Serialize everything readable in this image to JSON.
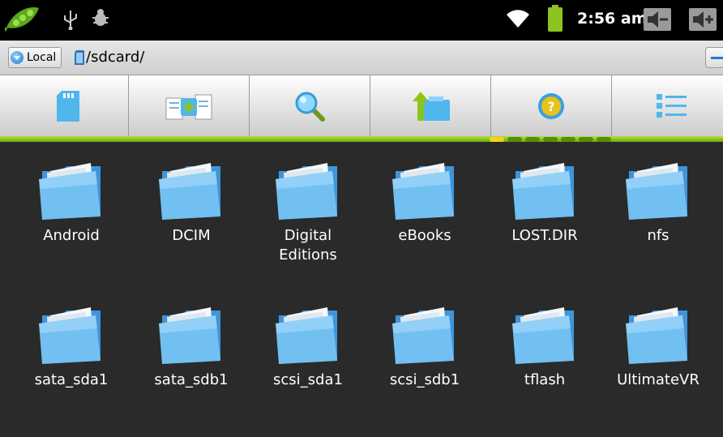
{
  "status_bar": {
    "time": "2:56 am",
    "left_icons": [
      "pea-pod-icon",
      "usb-icon",
      "debug-icon"
    ],
    "right_icons": [
      "wifi-icon",
      "battery-icon",
      "volume-down-icon",
      "volume-up-icon"
    ]
  },
  "path_bar": {
    "location_label": "Local",
    "path": "/sdcard/"
  },
  "toolbar": {
    "buttons": [
      {
        "icon": "sdcard-icon"
      },
      {
        "icon": "multi-select-icon"
      },
      {
        "icon": "search-icon"
      },
      {
        "icon": "up-folder-icon"
      },
      {
        "icon": "help-icon"
      },
      {
        "icon": "list-view-icon"
      }
    ]
  },
  "files": [
    {
      "name": "Android"
    },
    {
      "name": "DCIM"
    },
    {
      "name": "Digital Editions"
    },
    {
      "name": "eBooks"
    },
    {
      "name": "LOST.DIR"
    },
    {
      "name": "nfs"
    },
    {
      "name": "sata_sda1"
    },
    {
      "name": "sata_sdb1"
    },
    {
      "name": "scsi_sda1"
    },
    {
      "name": "scsi_sdb1"
    },
    {
      "name": "tflash"
    },
    {
      "name": "UltimateVR"
    }
  ],
  "colors": {
    "accent_green": "#8cc41f",
    "folder_blue": "#6fb8ef",
    "background": "#2a2a2a"
  }
}
